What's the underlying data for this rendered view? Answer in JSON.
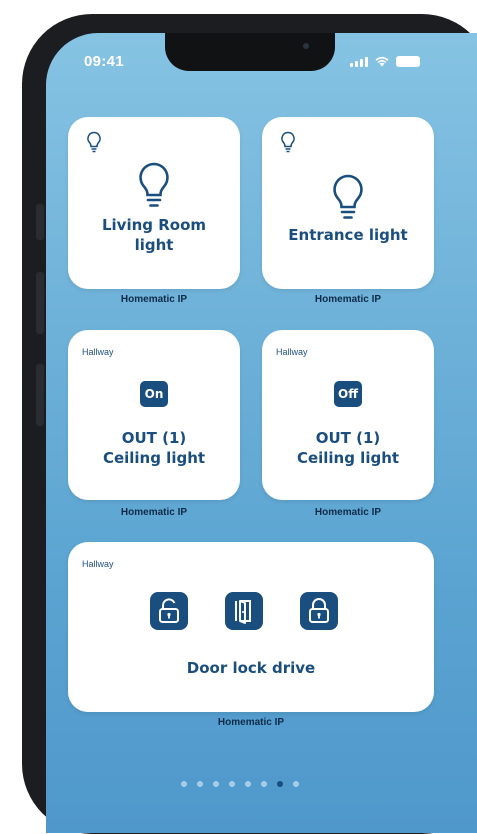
{
  "status_bar": {
    "time": "09:41"
  },
  "cards": {
    "living_room": {
      "title_line1": "Living Room",
      "title_line2": "light",
      "brand": "Homematic IP"
    },
    "entrance": {
      "title": "Entrance light",
      "brand": "Homematic IP"
    },
    "out_on": {
      "room": "Hallway",
      "state": "On",
      "title_line1": "OUT (1)",
      "title_line2": "Ceiling light",
      "brand": "Homematic IP"
    },
    "out_off": {
      "room": "Hallway",
      "state": "Off",
      "title_line1": "OUT (1)",
      "title_line2": "Ceiling light",
      "brand": "Homematic IP"
    },
    "door_lock": {
      "room": "Hallway",
      "title": "Door lock drive",
      "brand": "Homematic IP"
    }
  },
  "page_indicator": {
    "count": 8,
    "active_index": 6
  },
  "colors": {
    "accent": "#1a4e7f",
    "background_top": "#86c3e3",
    "background_bottom": "#4f98cb"
  }
}
